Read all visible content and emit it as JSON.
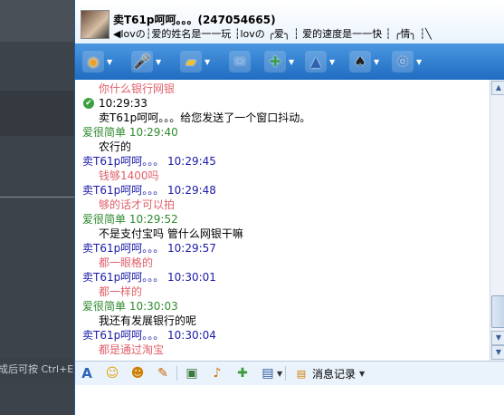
{
  "background_window": {
    "hint_text": "成后可按  Ctrl+E"
  },
  "contact": {
    "name": "卖T61p呵呵。。。(247054665)",
    "signature": "◀lovの┆爱的姓名是一一玩 ┆lovの ╭爱╮ ┆ 爱的速度是一一快 ┆ ╭情╮ ┆╲"
  },
  "toolbar": {
    "items": [
      {
        "name": "video-call",
        "icon": "webcam-icon",
        "glyph": "◉",
        "color": "#f0a020",
        "has_menu": true
      },
      {
        "name": "voice-call",
        "icon": "microphone-icon",
        "glyph": "🎤",
        "color": "#5a9be6",
        "has_menu": true
      },
      {
        "name": "send-file",
        "icon": "folder-icon",
        "glyph": "▰",
        "color": "#f2c030",
        "has_menu": true
      },
      {
        "name": "send-mail",
        "icon": "envelope-icon",
        "glyph": "✉",
        "color": "#6aa0d8",
        "has_menu": false
      },
      {
        "name": "create-group",
        "icon": "add-document-icon",
        "glyph": "✚",
        "color": "#3aa050",
        "has_menu": true
      },
      {
        "name": "remote-assist",
        "icon": "assist-icon",
        "glyph": "▲",
        "color": "#3060b0",
        "has_menu": true
      },
      {
        "name": "games",
        "icon": "cards-icon",
        "glyph": "♠",
        "color": "#222222",
        "has_menu": true
      },
      {
        "name": "settings",
        "icon": "gear-icon",
        "glyph": "⚙",
        "color": "#4a7cc0",
        "has_menu": true
      }
    ]
  },
  "messages": [
    {
      "text": "你什么银行网银",
      "type": "text-remote"
    },
    {
      "text": "10:29:33",
      "type": "system-time"
    },
    {
      "text": "卖T61p呵呵。。。给您发送了一个窗口抖动。",
      "type": "system"
    },
    {
      "text": "爱很简单  10:29:40",
      "type": "header-self"
    },
    {
      "text": "农行的",
      "type": "text-self"
    },
    {
      "text": "卖T61p呵呵。。。   10:29:45",
      "type": "header-remote"
    },
    {
      "text": "钱够1400吗",
      "type": "text-remote"
    },
    {
      "text": "卖T61p呵呵。。。   10:29:48",
      "type": "header-remote"
    },
    {
      "text": "够的话才可以拍",
      "type": "text-remote"
    },
    {
      "text": "爱很简单  10:29:52",
      "type": "header-self"
    },
    {
      "text": "不是支付宝吗   管什么网银干嘛",
      "type": "text-self"
    },
    {
      "text": "卖T61p呵呵。。。   10:29:57",
      "type": "header-remote"
    },
    {
      "text": "都一眼格的",
      "type": "text-remote"
    },
    {
      "text": "卖T61p呵呵。。。   10:30:01",
      "type": "header-remote"
    },
    {
      "text": "都一样的",
      "type": "text-remote"
    },
    {
      "text": "爱很简单  10:30:03",
      "type": "header-self"
    },
    {
      "text": "我还有发展银行的呢",
      "type": "text-self"
    },
    {
      "text": "卖T61p呵呵。。。   10:30:04",
      "type": "header-remote"
    },
    {
      "text": "都是通过淘宝",
      "type": "text-remote"
    }
  ],
  "format_bar": {
    "tools": [
      {
        "name": "font",
        "icon": "font-icon",
        "glyph": "A",
        "color": "#2a64b8"
      },
      {
        "name": "emoticon",
        "icon": "smiley-icon",
        "glyph": "☺",
        "color": "#e6a000"
      },
      {
        "name": "magic-emoticon",
        "icon": "magic-face-icon",
        "glyph": "☻",
        "color": "#d08000"
      },
      {
        "name": "scrawl",
        "icon": "scrawl-face-icon",
        "glyph": "✎",
        "color": "#c86400"
      },
      {
        "name": "image",
        "icon": "picture-icon",
        "glyph": "▣",
        "color": "#3a7a3a"
      },
      {
        "name": "music",
        "icon": "music-icon",
        "glyph": "♪",
        "color": "#d07000"
      },
      {
        "name": "gift",
        "icon": "gift-icon",
        "glyph": "✚",
        "color": "#3a9a3a"
      },
      {
        "name": "screenshot",
        "icon": "screen-capture-icon",
        "glyph": "▤",
        "color": "#2d5aa0"
      }
    ],
    "history_label": "消息记录",
    "history_icon": "history-icon"
  },
  "colors": {
    "self": "#2e8b2e",
    "remote_header": "#1a1aa8",
    "remote_text": "#e0606a",
    "system": "#000000",
    "text": "#000000"
  }
}
